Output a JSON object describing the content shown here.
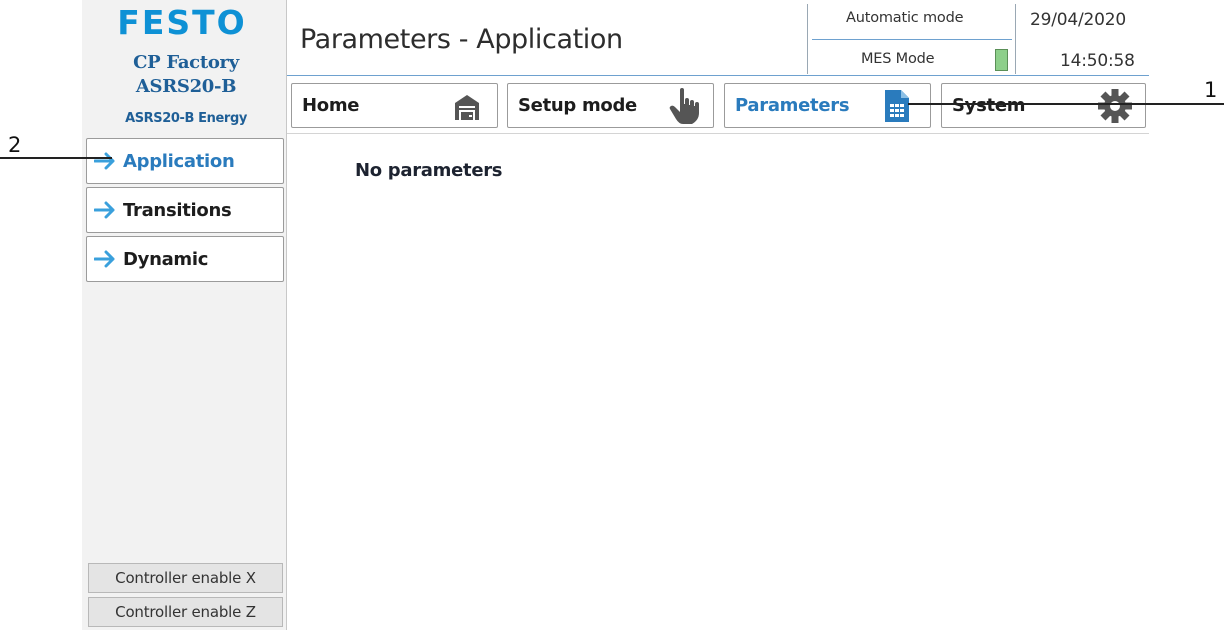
{
  "brand": {
    "logo_text": "FESTO",
    "color": "#0e91d5"
  },
  "station": {
    "line1": "CP Factory",
    "line2": "ASRS20-B",
    "line3": "ASRS20-B Energy"
  },
  "header": {
    "title": "Parameters - Application",
    "mode": "Automatic mode",
    "mes_mode": "MES Mode",
    "mes_status_color": "#8dcf8a",
    "date": "29/04/2020",
    "time": "14:50:58"
  },
  "top_nav": [
    {
      "label": "Home",
      "icon": "garage-icon",
      "active": false
    },
    {
      "label": "Setup mode",
      "icon": "hand-pointer-icon",
      "active": false
    },
    {
      "label": "Parameters",
      "icon": "spreadsheet-document-icon",
      "active": true
    },
    {
      "label": "System",
      "icon": "gear-icon",
      "active": false
    }
  ],
  "sidebar": {
    "items": [
      {
        "label": "Application",
        "icon": "arrow-right-icon",
        "active": true
      },
      {
        "label": "Transitions",
        "icon": "arrow-right-icon",
        "active": false
      },
      {
        "label": "Dynamic",
        "icon": "arrow-right-icon",
        "active": false
      }
    ],
    "controls": [
      {
        "label": "Controller enable X"
      },
      {
        "label": "Controller enable Z"
      }
    ]
  },
  "main": {
    "message": "No parameters"
  },
  "callouts": {
    "one": "1",
    "two": "2"
  },
  "colors": {
    "accent": "#2a7bbd",
    "arrow": "#3aa0dc",
    "icon_gray": "#555555"
  }
}
